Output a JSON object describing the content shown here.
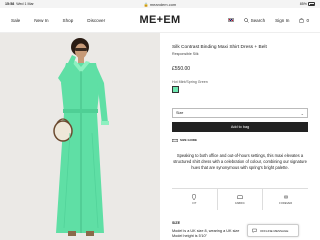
{
  "status": {
    "time": "15:58",
    "date": "Wed 1 Mar",
    "url": "meandem.com",
    "battery": "85%"
  },
  "nav": {
    "links": [
      "Sale",
      "New In",
      "Shop",
      "Discover"
    ],
    "logo": "ME+EM",
    "search_label": "Search",
    "sign_in_label": "Sign In",
    "bag_count": "0"
  },
  "product": {
    "title": "Silk Contrast Binding Maxi Shirt Dress + Belt",
    "subtitle": "Responsible Silk",
    "price": "£550.00",
    "colour_name": "Hot Mint/Spring Green",
    "swatch_color": "#6ee6b0",
    "size_placeholder": "Size",
    "add_to_bag_label": "Add to bag",
    "size_guide_label": "SIZE GUIDE",
    "description": "Speaking to both office and out-of-hours settings, this maxi elevates a structured shirt dress with a celebration of colour, combining our signature hues that are synonymous with spring's bright palette.",
    "features": [
      {
        "label": "FIT",
        "icon": "fit-icon"
      },
      {
        "label": "FABRIC",
        "icon": "fabric-icon"
      },
      {
        "label": "FOREVER",
        "icon": "forever-icon"
      }
    ],
    "size_heading": "SIZE",
    "size_text_line1": "Model is a UK size 8, wearing a UK size",
    "size_text_line2": "Model height is 5'10\""
  },
  "chat": {
    "label": "OFFLINE MESSAGE"
  }
}
